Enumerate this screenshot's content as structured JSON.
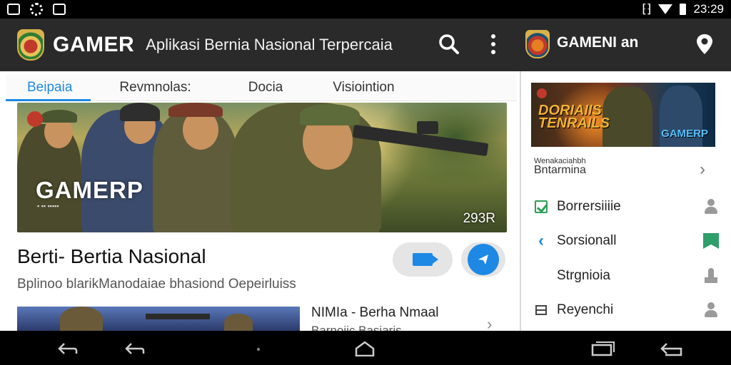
{
  "status_bar": {
    "time": "23:29",
    "icons": [
      "image-icon",
      "gear-icon",
      "app-icon",
      "vibrate-icon",
      "wifi-icon",
      "battery-icon"
    ]
  },
  "app_bar": {
    "brand": "GAMER",
    "subtitle": "Aplikasi Bernia Nasional Terpercaia",
    "right_brand": "GAMENI an",
    "icons": [
      "search-icon",
      "more-vert-icon",
      "location-icon"
    ]
  },
  "tabs": [
    {
      "label": "Beipaia",
      "active": true
    },
    {
      "label": "Revmnolas:",
      "active": false
    },
    {
      "label": "Docia",
      "active": false
    },
    {
      "label": "Visiointion",
      "active": false
    }
  ],
  "hero": {
    "title": "GAMERP",
    "small_text": "▪ ▪▪ ▪▪▪▪▪",
    "count": "293R"
  },
  "article": {
    "headline": "Berti- Bertia Nasional",
    "description": "Bplinoo blarikManodaiae bhasiond Oepeirluiss"
  },
  "second_article": {
    "title": "NIMIa - Berha Nmaal",
    "subtitle": "Barnoiic Basiaris"
  },
  "sidebar": {
    "banner_title": "DORIAIIS TENRAILS",
    "banner_label": "GAMERP",
    "section_label_small": "Wenakaciahbh",
    "section_label": "Bntarmina",
    "items": [
      {
        "label": "Borrersiiiie",
        "lead_icon": "check-icon",
        "trail_icon": "person-icon"
      },
      {
        "label": "Sorsionall",
        "lead_icon": "back-arrow-icon",
        "trail_icon": "flag-icon"
      },
      {
        "label": "Strgnioia",
        "lead_icon": "",
        "trail_icon": "sign-icon"
      },
      {
        "label": "Reyenchi",
        "lead_icon": "list-icon",
        "trail_icon": "person-icon"
      }
    ]
  },
  "colors": {
    "accent": "#1e88e5",
    "appbar": "#2a2a2a",
    "green": "#2e9e55"
  }
}
